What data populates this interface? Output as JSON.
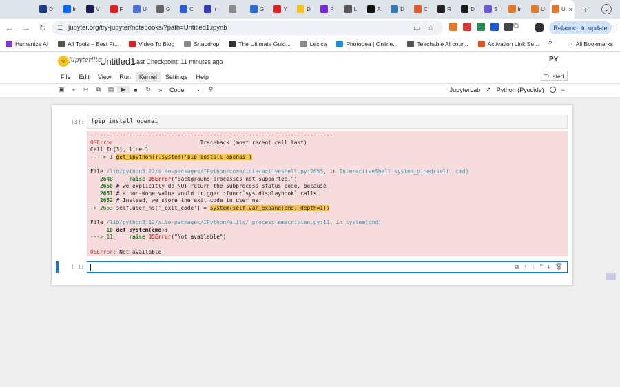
{
  "browser": {
    "tabs": [
      {
        "letter": "D",
        "color": "#1f3c8a",
        "icon": "d-favicon"
      },
      {
        "letter": "Ir",
        "color": "#0866ff",
        "icon": "meta-favicon"
      },
      {
        "letter": "V",
        "color": "#1a1a4d",
        "icon": "video-favicon"
      },
      {
        "letter": "F",
        "color": "#e02020",
        "icon": "youtube-favicon"
      },
      {
        "letter": "U",
        "color": "#4a6fd8",
        "icon": "doc-favicon"
      },
      {
        "letter": "G",
        "color": "#666666",
        "icon": "g-favicon"
      },
      {
        "letter": "C",
        "color": "#2a5bd7",
        "icon": "io-favicon"
      },
      {
        "letter": "Ir",
        "color": "#3b3bb5",
        "icon": "i-favicon"
      },
      {
        "letter": "",
        "color": "#8a8a8a",
        "icon": "script-favicon"
      },
      {
        "letter": "G",
        "color": "#2a6dd8",
        "icon": "g2-favicon"
      },
      {
        "letter": "Y",
        "color": "#e02020",
        "icon": "youtube2-favicon"
      },
      {
        "letter": "D",
        "color": "#f0c419",
        "icon": "bolt-favicon"
      },
      {
        "letter": "P",
        "color": "#7a2ad8",
        "icon": "p-favicon"
      },
      {
        "letter": "L",
        "color": "#555555",
        "icon": "l-favicon"
      },
      {
        "letter": "A",
        "color": "#111111",
        "icon": "ai-favicon"
      },
      {
        "letter": "D",
        "color": "#3a78b5",
        "icon": "python-favicon"
      },
      {
        "letter": "C",
        "color": "#e05a2a",
        "icon": "c-favicon"
      },
      {
        "letter": "R",
        "color": "#222222",
        "icon": "r-favicon"
      },
      {
        "letter": "D",
        "color": "#1a1a1a",
        "icon": "d2-favicon"
      },
      {
        "letter": "B",
        "color": "#6a5ad8",
        "icon": "b-favicon"
      },
      {
        "letter": "Ir",
        "color": "#e07a2a",
        "icon": "ir-favicon"
      },
      {
        "letter": "U",
        "color": "#e07a2a",
        "icon": "u-favicon"
      }
    ],
    "active_tab": {
      "letter": "U",
      "close": "×"
    },
    "new_tab": "+",
    "url": "jupyter.org/try-jupyter/notebooks/?path=Untitled1.ipynb",
    "relaunch": "Relaunch to update",
    "ext_colors": [
      "#e07a2a",
      "#d83a3a",
      "#2a8a5a",
      "#1a5ad8",
      "#444444"
    ],
    "bookmarks": [
      {
        "label": "Humanize AI",
        "color": "#7a3ad8"
      },
      {
        "label": "All Tools – Best Fr...",
        "color": "#555555"
      },
      {
        "label": "Video To Blog",
        "color": "#e02020"
      },
      {
        "label": "Snapdrop",
        "color": "#888888"
      },
      {
        "label": "The Ultimate Guid...",
        "color": "#333333"
      },
      {
        "label": "Lexica",
        "color": "#888888"
      },
      {
        "label": "Photopea | Online...",
        "color": "#1a8ad8"
      },
      {
        "label": "Teachable AI cour...",
        "color": "#555555"
      },
      {
        "label": "Activation Link Se...",
        "color": "#e05a2a"
      }
    ],
    "bookmarks_more": "»",
    "all_bookmarks": "All Bookmarks"
  },
  "jupyter": {
    "logo_text": "jupyterlite",
    "title": "Untitled1",
    "checkpoint": "Last Checkpoint: 11 minutes ago",
    "py_logo": "PY",
    "menus": [
      "File",
      "Edit",
      "View",
      "Run",
      "Kernel",
      "Settings",
      "Help"
    ],
    "trusted": "Trusted",
    "cell_type": "Code",
    "jupyterlab_link": "JupyterLab",
    "kernel": "Python (Pyodide)"
  },
  "cell1": {
    "prompt": "[3]:",
    "source": "!pip install openai"
  },
  "error": {
    "dashes": "---------------------------------------------------------------------------",
    "name": "OSError",
    "traceback": "Traceback (most recent call last)",
    "cell_line": "Cell In[3], line 1",
    "arrow1": "----> 1 ",
    "hl1": "get_ipython().system('pip install openai')",
    "file1_prefix": "File ",
    "file1_path": "/lib/python3.12/site-packages/IPython/core/interactiveshell.py:2653",
    "file1_in": ", in ",
    "file1_func": "InteractiveShell.system_piped",
    "file1_args": "(self, cmd)",
    "l2648_num": "   2648",
    "l2648_kw": "raise",
    "l2648_cls": "OSError",
    "l2648_rest": "(\"Background processes not supported.\")",
    "l2650_num": "   2650",
    "l2650_txt": "# we explicitly do NOT return the subprocess status code, because",
    "l2651_num": "   2651",
    "l2651_txt": "# a non-None value would trigger :func:`sys.displayhook` calls.",
    "l2652_num": "   2652",
    "l2652_txt": "# Instead, we store the exit_code in user_ns.",
    "l2653_arrow": "-> 2653 ",
    "l2653_pre": "self.user_ns['_exit_code'] = ",
    "l2653_hl": "system(self.var_expand(cmd, depth=1))",
    "file2_prefix": "File ",
    "file2_path": "/lib/python3.12/site-packages/IPython/utils/_process_emscripten.py:11",
    "file2_in": ", in ",
    "file2_func": "system",
    "file2_args": "(cmd)",
    "l10_num": "     10",
    "l10_txt": "def system(cmd):",
    "l11_arrow": "---> 11 ",
    "l11_kw": "raise",
    "l11_cls": "OSError",
    "l11_rest": "(\"Not available\")",
    "final_name": "OSError",
    "final_msg": ": Not available"
  },
  "cell2": {
    "prompt": "[ ]:",
    "source": ""
  }
}
